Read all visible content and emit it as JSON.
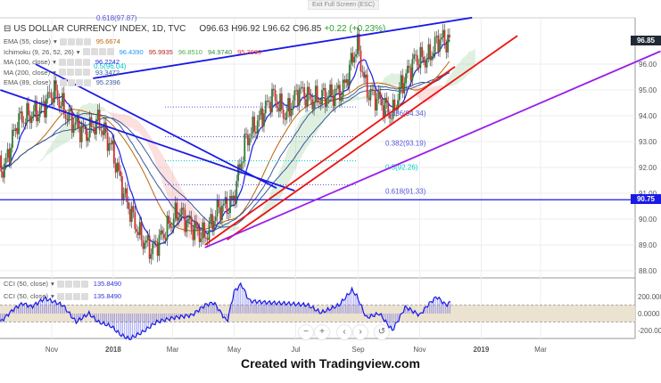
{
  "header": {
    "symbol": "US DOLLAR CURRENCY INDEX, 1D, TVC",
    "open": "O96.63",
    "high": "H96.92",
    "low": "L96.62",
    "close": "C96.85",
    "change": "+0.22 (+0.23%)",
    "exit_fullscreen": "Exit Full Screen (ESC)"
  },
  "indicators": [
    {
      "label": "EMA (55, close)",
      "values": [
        "95.6674"
      ],
      "colors": [
        "#b8650b"
      ]
    },
    {
      "label": "Ichimoku (9, 26, 52, 26)",
      "values": [
        "96.4390",
        "95.9935",
        "96.8510",
        "94.9740",
        "95.3990"
      ],
      "colors": [
        "#2196f3",
        "#b71c1c",
        "#4caf50",
        "#388e3c",
        "#e53935"
      ]
    },
    {
      "label": "MA (100, close)",
      "values": [
        "96.2242"
      ],
      "colors": [
        "#2a2ae0"
      ]
    },
    {
      "label": "MA (200, close)",
      "values": [
        "93.3472"
      ],
      "colors": [
        "#3a5a9a"
      ]
    },
    {
      "label": "EMA (89, close)",
      "values": [
        "95.2396"
      ],
      "colors": [
        "#3a5a9a"
      ]
    }
  ],
  "cci_legends": [
    {
      "label": "CCI (50, close)",
      "value": "135.8490"
    },
    {
      "label": "CCI (50, close)",
      "value": "135.8490"
    }
  ],
  "price_labels": {
    "last": "96.85",
    "level": "90.75"
  },
  "footer": "Created with Tradingview.com",
  "controls": [
    "−",
    "+",
    "‹",
    "›",
    "↺"
  ],
  "chart_data": {
    "type": "candlestick",
    "title": "US DOLLAR CURRENCY INDEX, 1D, TVC",
    "day_origin": "2017-09-01",
    "price_keypoints": [
      [
        14,
        92.0
      ],
      [
        27,
        93.8
      ],
      [
        49,
        94.2
      ],
      [
        63,
        95.0
      ],
      [
        76,
        94.0
      ],
      [
        94,
        93.3
      ],
      [
        107,
        93.8
      ],
      [
        120,
        92.8
      ],
      [
        134,
        90.8
      ],
      [
        149,
        89.3
      ],
      [
        160,
        88.8
      ],
      [
        173,
        89.5
      ],
      [
        187,
        90.3
      ],
      [
        200,
        89.7
      ],
      [
        213,
        89.3
      ],
      [
        226,
        90.4
      ],
      [
        240,
        90.6
      ],
      [
        253,
        93.0
      ],
      [
        266,
        93.8
      ],
      [
        280,
        94.8
      ],
      [
        293,
        94.0
      ],
      [
        306,
        95.0
      ],
      [
        319,
        94.6
      ],
      [
        337,
        94.8
      ],
      [
        350,
        95.0
      ],
      [
        364,
        96.8
      ],
      [
        373,
        95.0
      ],
      [
        386,
        94.6
      ],
      [
        399,
        94.0
      ],
      [
        408,
        95.2
      ],
      [
        421,
        96.2
      ],
      [
        434,
        96.2
      ],
      [
        445,
        97.0
      ],
      [
        457,
        96.85
      ]
    ],
    "cci_keypoints": [
      [
        10,
        -100
      ],
      [
        23,
        50
      ],
      [
        32,
        120
      ],
      [
        41,
        80
      ],
      [
        54,
        180
      ],
      [
        72,
        100
      ],
      [
        85,
        -100
      ],
      [
        98,
        0
      ],
      [
        107,
        -100
      ],
      [
        120,
        -150
      ],
      [
        129,
        -250
      ],
      [
        138,
        -300
      ],
      [
        151,
        -220
      ],
      [
        165,
        -100
      ],
      [
        182,
        -50
      ],
      [
        200,
        -20
      ],
      [
        213,
        100
      ],
      [
        222,
        130
      ],
      [
        235,
        -100
      ],
      [
        242,
        260
      ],
      [
        249,
        350
      ],
      [
        257,
        150
      ],
      [
        275,
        130
      ],
      [
        293,
        120
      ],
      [
        315,
        100
      ],
      [
        328,
        10
      ],
      [
        346,
        100
      ],
      [
        359,
        280
      ],
      [
        364,
        200
      ],
      [
        373,
        -50
      ],
      [
        386,
        0
      ],
      [
        399,
        -200
      ],
      [
        412,
        80
      ],
      [
        426,
        -20
      ],
      [
        434,
        100
      ],
      [
        443,
        200
      ],
      [
        452,
        100
      ],
      [
        457,
        136
      ]
    ],
    "trendlines": [
      {
        "color": "#1a1ae6",
        "from": [
          102,
          95.45
        ],
        "to": [
          478,
          97.8
        ]
      },
      {
        "color": "#1a1ae6",
        "from": [
          10,
          95.0
        ],
        "to": [
          302,
          91.1
        ]
      },
      {
        "color": "#1a1ae6",
        "from": [
          45,
          96.0
        ],
        "to": [
          284,
          91.2
        ]
      },
      {
        "color": "#ee1111",
        "from": [
          235,
          89.2
        ],
        "to": [
          523,
          97.1
        ]
      },
      {
        "color": "#ee1111",
        "from": [
          213,
          89.0
        ],
        "to": [
          461,
          95.9
        ]
      },
      {
        "color": "#9b1ee8",
        "from": [
          213,
          88.9
        ],
        "to": [
          665,
          96.5
        ]
      }
    ],
    "horizontal_level": 90.75,
    "fib_levels": [
      {
        "label": "0.236(94.34)",
        "value": 94.34
      },
      {
        "label": "0.382(93.19)",
        "value": 93.19
      },
      {
        "label": "0.5(92.26)",
        "value": 92.26
      },
      {
        "label": "0.618(91.33)",
        "value": 91.33
      }
    ],
    "fib_top_labels": [
      "0.618(97.87)",
      "0.5(96.04)"
    ],
    "y_ticks": [
      "96.00",
      "95.00",
      "94.00",
      "93.00",
      "92.00",
      "91.00",
      "90.00",
      "89.00",
      "88.00"
    ],
    "cci_ticks": [
      "200.0000",
      "0.0000",
      "-200.0000"
    ],
    "cci_band": [
      -100,
      100
    ],
    "x_ticks": [
      {
        "label": "Nov",
        "day": 61
      },
      {
        "label": "2018",
        "day": 122
      },
      {
        "label": "Mar",
        "day": 181
      },
      {
        "label": "May",
        "day": 242
      },
      {
        "label": "Jul",
        "day": 303
      },
      {
        "label": "Sep",
        "day": 365
      },
      {
        "label": "Nov",
        "day": 426
      },
      {
        "label": "2019",
        "day": 487
      },
      {
        "label": "Mar",
        "day": 546
      }
    ],
    "ylim": [
      87.8,
      98.2
    ]
  }
}
